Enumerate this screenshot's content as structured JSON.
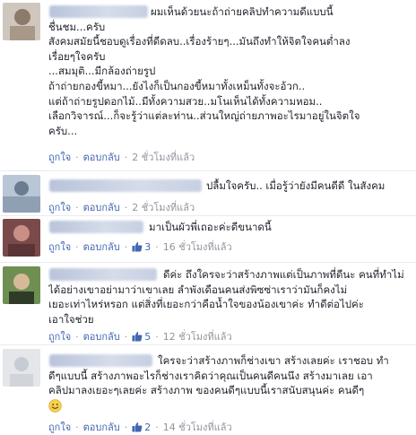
{
  "actions": {
    "like_label": "ถูกใจ",
    "reply_label": "ตอบกลับ",
    "separator": "·"
  },
  "comments": [
    {
      "lines": [
        "ผมเห็นด้วยนะถ้าถ่ายคลิปทำความดีแบบนี้",
        "ชื่นชม...ครับ",
        "สังคมสมัยนี้ชอบดูเรื่องที่ดีดลบ..เรื่องร้ายๆ...มันถึงทำให้จิตใจคนต่ำลง",
        "เรื่อยๆใจครับ",
        "...สมมุติ...มีกล้องถ่ายรูป",
        "ถ้าถ่ายกองขี้หมา...ยังไงก็เป็นกองขี้หมาทั้งเหม็นทั้งจะอ้วก..",
        "แต่ถ้าถ่ายรูปดอกไม้..มีทั้งความสวย..มโนเห็นได้ทั้งความหอม..",
        "เลือกวิจารณ์...ก็จะรู้ว่าแต่ละท่าน..ส่วนใหญ่ถ่ายภาพอะไรมาอยู่ในจิตใจ",
        "ครับ..."
      ],
      "time": "2 ชั่วโมงที่แล้ว"
    },
    {
      "lines": [
        "ปลื้มใจครับ.. เมื่อรู้ว่ายังมีคนดีดี ในสังคม"
      ],
      "time": "2 ชั่วโมงที่แล้ว"
    },
    {
      "lines": [
        "มาเป็นผัวพี่เถอะค่ะดีขนาดนี้"
      ],
      "likes": "3",
      "time": "16 ชั่วโมงที่แล้ว"
    },
    {
      "lines": [
        "ดีค่ะ ถึงใครจะว่าสร้างภาพแต่เป็นภาพที่ดีนะ คนที่ทำไม่",
        "ได้อย่างเขาอย่ามาว่าเขาเลย ลำพังเดือนคนส่งพิซซ่าเราว่ามันก็คงไม่",
        "เยอะเท่าไหร่หรอก แต่สิ่งที่เยอะกว่าคือน้ำใจของน้องเขาค่ะ ทำดีต่อไปค่ะ",
        "เอาใจช่วย"
      ],
      "likes": "5",
      "time": "12 ชั่วโมงที่แล้ว"
    },
    {
      "lines": [
        "ใครจะว่าสร้างภาพก็ช่างเขา สร้างเลยค่ะ เราชอบ ทำ",
        "ดีๆแบบนี้ สร้างภาพอะไรก็ช่างเราคิดว่าคุณเป็นคนดีคนนึง สร้างมาเลย เอา",
        "คลิปมาลงเยอะๆเลยค่ะ สร้างภาพ ของคนดีๆแบบนี้เราสนับสนุนค่ะ คนดีๆ"
      ],
      "likes": "2",
      "time": "14 ชั่วโมงที่แล้ว"
    }
  ],
  "colors": {
    "link": "#4267b2",
    "meta": "#90949c",
    "text": "#1d2129",
    "divider": "#e9ebee"
  }
}
